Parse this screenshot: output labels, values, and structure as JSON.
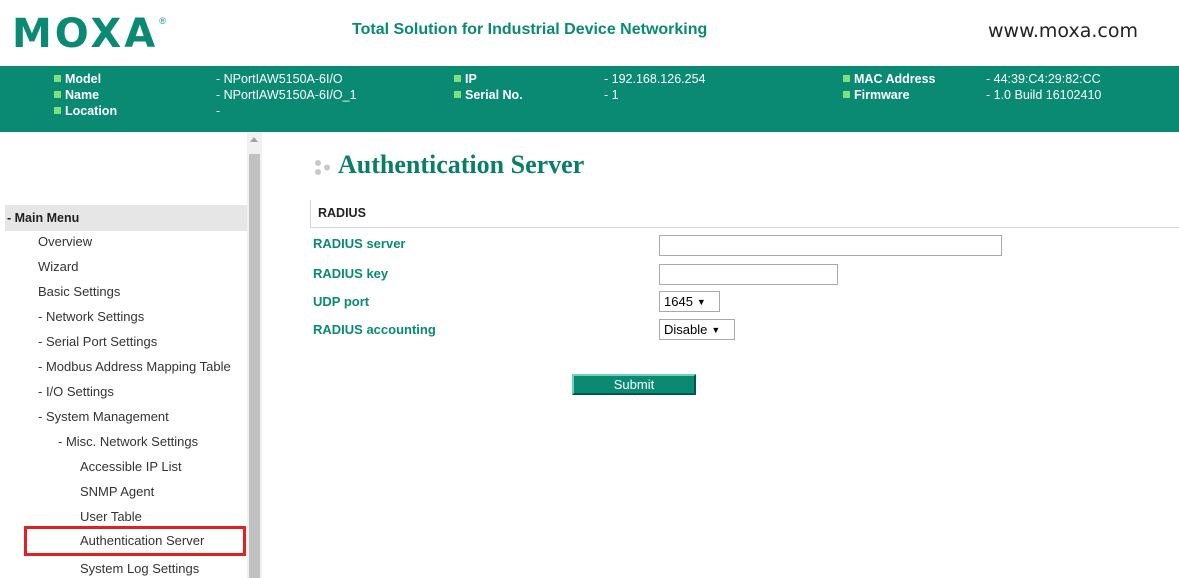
{
  "header": {
    "logo_text": "MOXA",
    "logo_registered": "®",
    "tagline": "Total Solution for Industrial Device Networking",
    "website": "www.moxa.com"
  },
  "info": {
    "model_label": "Model",
    "model_value": "- NPortIAW5150A-6I/O",
    "name_label": "Name",
    "name_value": "- NPortIAW5150A-6I/O_1",
    "location_label": "Location",
    "location_value": "-",
    "ip_label": "IP",
    "ip_value": "- 192.168.126.254",
    "serial_label": "Serial No.",
    "serial_value": "- 1",
    "mac_label": "MAC Address",
    "mac_value": "- 44:39:C4:29:82:CC",
    "firmware_label": "Firmware",
    "firmware_value": "- 1.0 Build 16102410"
  },
  "sidebar": {
    "header": "- Main Menu",
    "items": [
      {
        "label": "Overview"
      },
      {
        "label": "Wizard"
      },
      {
        "label": "Basic Settings"
      },
      {
        "label": "- Network Settings"
      },
      {
        "label": "- Serial Port Settings"
      },
      {
        "label": "- Modbus Address Mapping Table"
      },
      {
        "label": "- I/O Settings"
      },
      {
        "label": "- System Management"
      },
      {
        "label": "- Misc. Network Settings"
      },
      {
        "label": "Accessible IP List"
      },
      {
        "label": "SNMP Agent"
      },
      {
        "label": "User Table"
      },
      {
        "label": "Authentication Server",
        "selected": true
      },
      {
        "label": "System Log Settings"
      }
    ]
  },
  "main": {
    "title": "Authentication Server",
    "section": "RADIUS",
    "fields": {
      "server_label": "RADIUS server",
      "server_value": "",
      "key_label": "RADIUS key",
      "key_value": "",
      "udp_label": "UDP port",
      "udp_value": "1645",
      "accounting_label": "RADIUS accounting",
      "accounting_value": "Disable"
    },
    "submit_label": "Submit"
  },
  "colors": {
    "brand": "#0a8a72",
    "highlight": "#e32020"
  }
}
